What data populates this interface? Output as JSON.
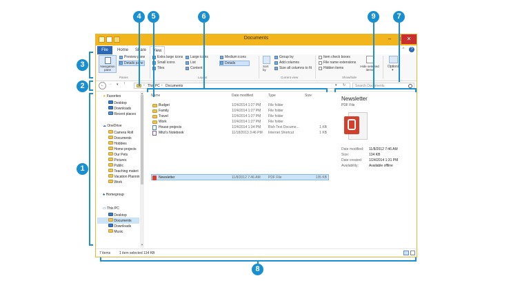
{
  "window": {
    "title": "Documents",
    "buttons": {
      "minimize": "–",
      "maximize": "□",
      "close": "✕"
    }
  },
  "tabs": [
    "File",
    "Home",
    "Share",
    "View"
  ],
  "ribbon": {
    "panes": {
      "navigation_pane": "Navigation pane",
      "preview_pane": "Preview pane",
      "details_pane": "Details pane",
      "group": "Panes"
    },
    "layout": {
      "items": [
        "Extra large icons",
        "Large icons",
        "Medium icons",
        "Small icons",
        "List",
        "Details",
        "Tiles",
        "Content"
      ],
      "group": "Layout"
    },
    "current_view": {
      "sort_by": "Sort by",
      "group_by": "Group by",
      "add_columns": "Add columns",
      "size_all": "Size all columns to fit",
      "group": "Current view"
    },
    "show_hide": {
      "item_check_boxes": "Item check boxes",
      "file_name_extensions": "File name extensions",
      "hidden_items": "Hidden items",
      "hide_selected": "Hide selected items",
      "group": "Show/hide"
    },
    "options": "Options"
  },
  "address": {
    "back": "←",
    "forward": "→",
    "recent": "▾",
    "up": "↑",
    "path": [
      "This PC",
      "Documents"
    ],
    "separator": "›",
    "search_placeholder": "Search Documents",
    "refresh": "↻",
    "dropdown": "▾"
  },
  "nav": {
    "favorites": "Favorites",
    "favorites_items": [
      "Desktop",
      "Downloads",
      "Recent places"
    ],
    "onedrive": "OneDrive",
    "onedrive_items": [
      "Camera Roll",
      "Documents",
      "Hobbies",
      "Home projects",
      "Our Pets",
      "Pictures",
      "Public",
      "Teaching materi",
      "Vacation Plannin",
      "Work"
    ],
    "homegroup": "Homegroup",
    "thispc": "This PC",
    "thispc_items": [
      "Desktop",
      "Documents",
      "Downloads",
      "Music"
    ]
  },
  "files": {
    "headers": {
      "name": "Name",
      "date": "Date modified",
      "type": "Type",
      "size": "Size"
    },
    "rows": [
      {
        "name": "Budget",
        "date": "1/24/2014 1:27 PM",
        "type": "File folder",
        "size": ""
      },
      {
        "name": "Family",
        "date": "1/24/2014 1:27 PM",
        "type": "File folder",
        "size": ""
      },
      {
        "name": "Travel",
        "date": "1/24/2014 1:27 PM",
        "type": "File folder",
        "size": ""
      },
      {
        "name": "Work",
        "date": "1/24/2014 1:27 PM",
        "type": "File folder",
        "size": ""
      },
      {
        "name": "House projects",
        "date": "1/24/2014 1:34 PM",
        "type": "Rich Text Docume...",
        "size": "1 KB"
      },
      {
        "name": "Mitzi's Notebook",
        "date": "11/18/2013 3:46 PM",
        "type": "Internet Shortcut",
        "size": "1 KB"
      },
      {
        "name": "Newsletter",
        "date": "11/8/2012 7:46 AM",
        "type": "PDF File",
        "size": "135 KB"
      }
    ]
  },
  "preview": {
    "title": "Newsletter",
    "subtitle": "PDF File",
    "fields": [
      {
        "label": "Date modified:",
        "value": "11/8/2012 7:46 AM"
      },
      {
        "label": "Size:",
        "value": "134 KB"
      },
      {
        "label": "Date created:",
        "value": "1/24/2014 1:31 PM"
      },
      {
        "label": "Availability:",
        "value": "Available offline"
      }
    ]
  },
  "status": {
    "count": "7 items",
    "selection": "1 item selected  134 KB"
  },
  "callouts": [
    "1",
    "2",
    "3",
    "4",
    "5",
    "6",
    "7",
    "8",
    "9"
  ],
  "colors": {
    "accent": "#1a8fd0",
    "titlebar": "#f2b51c",
    "file_tab": "#2b68b6",
    "selection": "#cce4f7"
  }
}
